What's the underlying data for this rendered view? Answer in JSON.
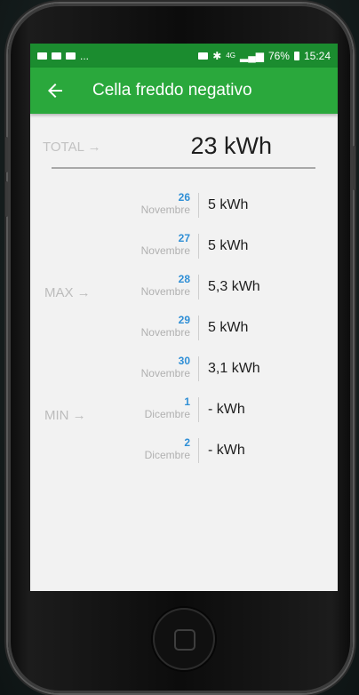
{
  "status": {
    "left_dots": "...",
    "network": "4G",
    "battery": "76%",
    "time": "15:24"
  },
  "appbar": {
    "title": "Cella freddo negativo"
  },
  "total": {
    "label": "TOTAL →",
    "value": "23 kWh"
  },
  "rows": [
    {
      "tag": "",
      "day": "26",
      "month": "Novembre",
      "value": "5 kWh"
    },
    {
      "tag": "",
      "day": "27",
      "month": "Novembre",
      "value": "5 kWh"
    },
    {
      "tag": "MAX →",
      "day": "28",
      "month": "Novembre",
      "value": "5,3 kWh"
    },
    {
      "tag": "",
      "day": "29",
      "month": "Novembre",
      "value": "5 kWh"
    },
    {
      "tag": "",
      "day": "30",
      "month": "Novembre",
      "value": "3,1 kWh"
    },
    {
      "tag": "MIN →",
      "day": "1",
      "month": "Dicembre",
      "value": "- kWh"
    },
    {
      "tag": "",
      "day": "2",
      "month": "Dicembre",
      "value": "- kWh"
    }
  ],
  "colors": {
    "appbar": "#2aa83c",
    "statusbar": "#1b8c2f",
    "day": "#2f8fd6"
  }
}
